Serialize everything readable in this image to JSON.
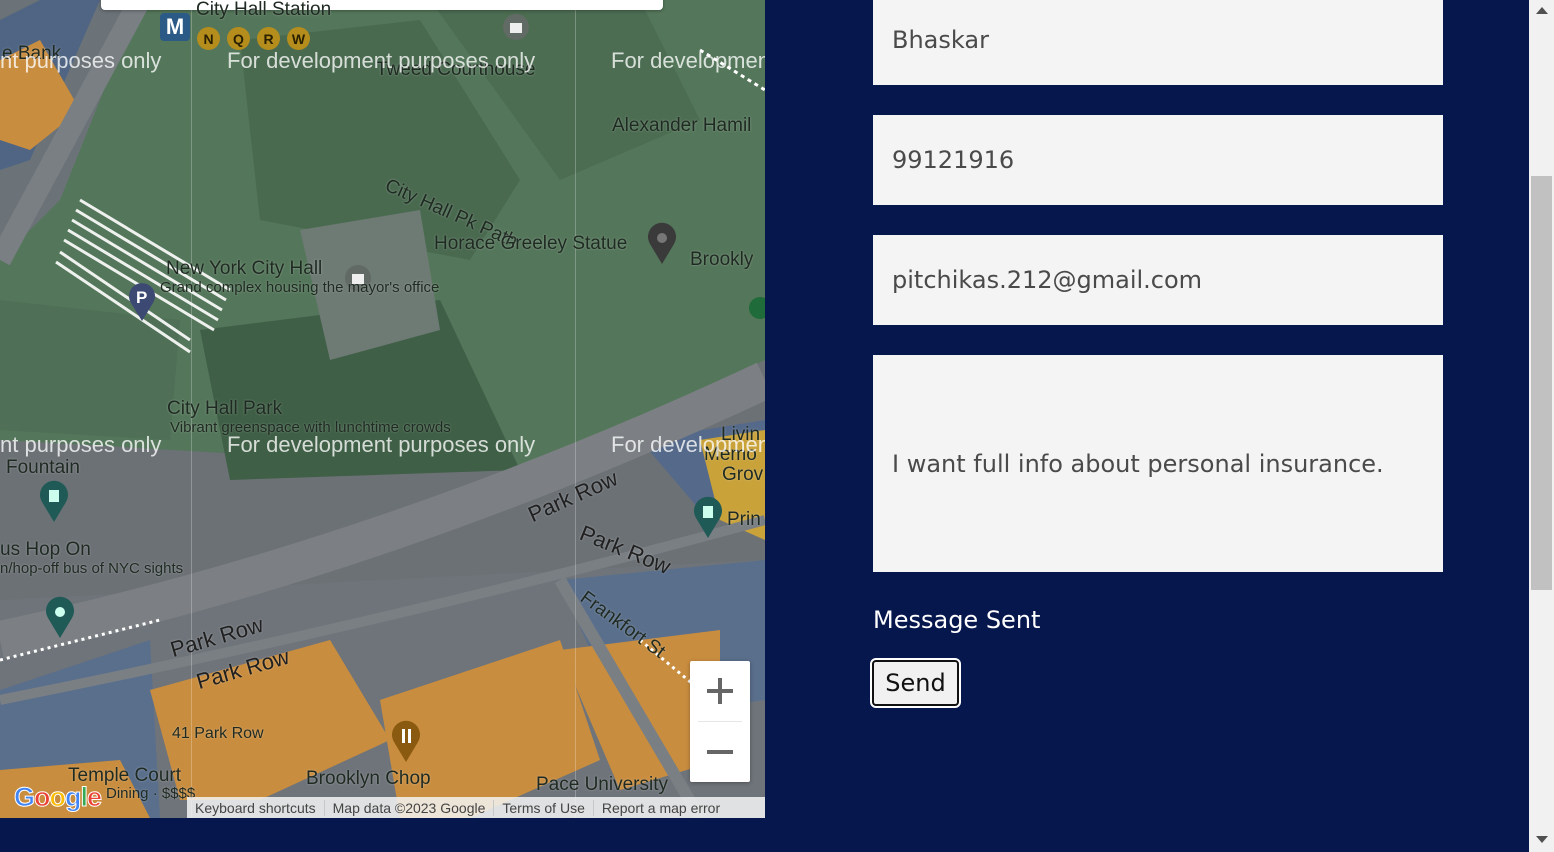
{
  "map": {
    "watermark_text": "For development purposes only",
    "watermark_partial_left": "nt purposes only",
    "watermark_partial_right": "For developmen",
    "labels": {
      "bank": "e Bank",
      "city_hall_station": "City Hall Station",
      "tweed": "Tweed Courthouse",
      "hamilton": "Alexander Hamil",
      "city_hall_pk_path": "City Hall Pk Path",
      "greeley": "Horace Greeley Statue",
      "brooklyn": "Brookly",
      "nych": "New York City Hall",
      "nych_sub": "Grand complex housing the mayor's office",
      "city_hall_park": "City Hall Park",
      "city_hall_park_sub": "Vibrant greenspace with lunchtime crowds",
      "fountain": "Fountain",
      "living": "Livin",
      "memorial": "Memo",
      "grove": "Grov",
      "print": "Prin",
      "park_row_1": "Park Row",
      "park_row_2": "Park Row",
      "park_row_3": "Park Row",
      "park_row_4": "Park Row",
      "frankfort": "Frankfort St",
      "hop_on": "us Hop On",
      "hop_on_sub": "n/hop-off bus of NYC sights",
      "park_row_41": "41 Park Row",
      "temple_court": "Temple Court",
      "dining": "Dining · $$$$",
      "brooklyn_chop": "Brooklyn Chop",
      "pace": "Pace University"
    },
    "subway_lines": [
      "N",
      "Q",
      "R",
      "W"
    ],
    "metro_badge": "M",
    "parking_badge": "P",
    "google_logo": "Google",
    "attribution": {
      "keyboard": "Keyboard shortcuts",
      "map_data": "Map data ©2023 Google",
      "terms": "Terms of Use",
      "report": "Report a map error"
    },
    "zoom_in": "+",
    "zoom_out": "−"
  },
  "form": {
    "name_value": "Bhaskar",
    "phone_value": "99121916",
    "email_value": "pitchikas.212@gmail.com",
    "message_value": "I want full info about personal insurance.",
    "status": "Message Sent",
    "send_label": "Send"
  },
  "colors": {
    "page_bg": "#06174d",
    "field_bg": "#f4f4f4",
    "park_green": "#54765a",
    "building_orange": "#c98d3f"
  }
}
